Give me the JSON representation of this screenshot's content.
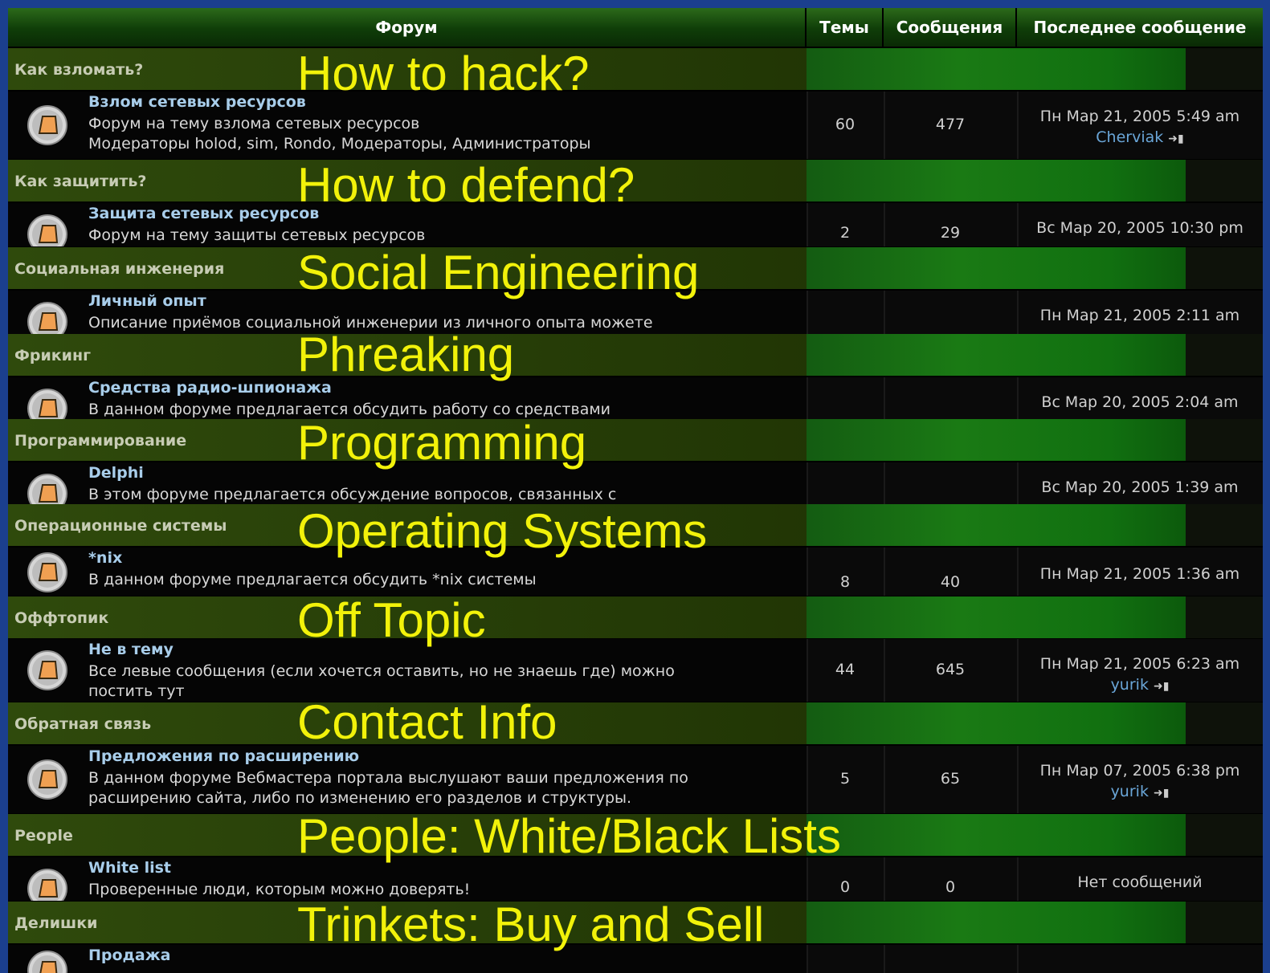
{
  "header": {
    "forum": "Форум",
    "topics": "Темы",
    "posts": "Сообщения",
    "last_post": "Последнее сообщение"
  },
  "categories": [
    {
      "name": "Как взломать?",
      "overlay": "How to hack?",
      "forum": {
        "name": "Взлом сетевых ресурсов",
        "desc": "Форум на тему взлома сетевых ресурсов",
        "desc2": "Модераторы holod, sim, Rondo, Модераторы, Администраторы",
        "topics": "60",
        "posts": "477",
        "last_date": "Пн Мар 21, 2005 5:49 am",
        "last_user": "Cherviak"
      }
    },
    {
      "name": "Как защитить?",
      "overlay": "How to defend?",
      "forum": {
        "name": "Защита сетевых ресурсов",
        "desc": "Форум на тему защиты сетевых ресурсов",
        "desc2": "",
        "topics": "2",
        "posts": "29",
        "last_date": "Вс Мар 20, 2005 10:30 pm",
        "last_user": ""
      }
    },
    {
      "name": "Социальная инженерия",
      "overlay": "Social Engineering",
      "forum": {
        "name": "Личный опыт",
        "desc": "Описание приёмов социальной инженерии из личного опыта можете",
        "desc2": "",
        "topics": "",
        "posts": "",
        "last_date": "Пн Мар 21, 2005 2:11 am",
        "last_user": ""
      }
    },
    {
      "name": "Фрикинг",
      "overlay": "Phreaking",
      "forum": {
        "name": "Средства радио-шпионажа",
        "desc": "В данном форуме предлагается обсудить работу со средствами",
        "desc2": "",
        "topics": "",
        "posts": "",
        "last_date": "Вс Мар 20, 2005 2:04 am",
        "last_user": ""
      }
    },
    {
      "name": "Программирование",
      "overlay": "Programming",
      "forum": {
        "name": "Delphi",
        "desc": "В этом форуме предлагается обсуждение вопросов, связанных с",
        "desc2": "",
        "topics": "",
        "posts": "",
        "last_date": "Вс Мар 20, 2005 1:39 am",
        "last_user": ""
      }
    },
    {
      "name": "Операционные системы",
      "overlay": "Operating Systems",
      "forum": {
        "name": "*nix",
        "desc": "В данном форуме предлагается обсудить *nix системы",
        "desc2": "",
        "topics": "8",
        "posts": "40",
        "last_date": "Пн Мар 21, 2005 1:36 am",
        "last_user": ""
      }
    },
    {
      "name": "Оффтопик",
      "overlay": "Off Topic",
      "forum": {
        "name": "Не в тему",
        "desc": "Все левые сообщения (если хочется оставить, но не знаешь где) можно",
        "desc2": "постить тут",
        "topics": "44",
        "posts": "645",
        "last_date": "Пн Мар 21, 2005 6:23 am",
        "last_user": "yurik"
      }
    },
    {
      "name": "Обратная связь",
      "overlay": "Contact Info",
      "forum": {
        "name": "Предложения по расширению",
        "desc": "В данном форуме Вебмастера портала выслушают ваши предложения по",
        "desc2": "расширению сайта, либо по изменению его разделов и структуры.",
        "topics": "5",
        "posts": "65",
        "last_date": "Пн Мар 07, 2005 6:38 pm",
        "last_user": "yurik"
      }
    },
    {
      "name": "People",
      "overlay": "People: White/Black Lists",
      "forum": {
        "name": "White list",
        "desc": "Проверенные люди, которым можно доверять!",
        "desc2": "",
        "topics": "0",
        "posts": "0",
        "last_date": "Нет сообщений",
        "last_user": ""
      }
    },
    {
      "name": "Делишки",
      "overlay": "Trinkets: Buy and Sell",
      "forum": {
        "name": "Продажа",
        "desc": "",
        "desc2": "",
        "topics": "",
        "posts": "",
        "last_date": "",
        "last_user": ""
      }
    }
  ],
  "icons": {
    "forum": "forum-folder-icon",
    "latest": "latest-post-icon"
  },
  "colors": {
    "overlay_text": "#f2f20a",
    "forum_link": "#a8cdea",
    "user_link": "#6aa6d8",
    "category_green": "#1a7a14",
    "page_frame": "#1b3f8e"
  }
}
